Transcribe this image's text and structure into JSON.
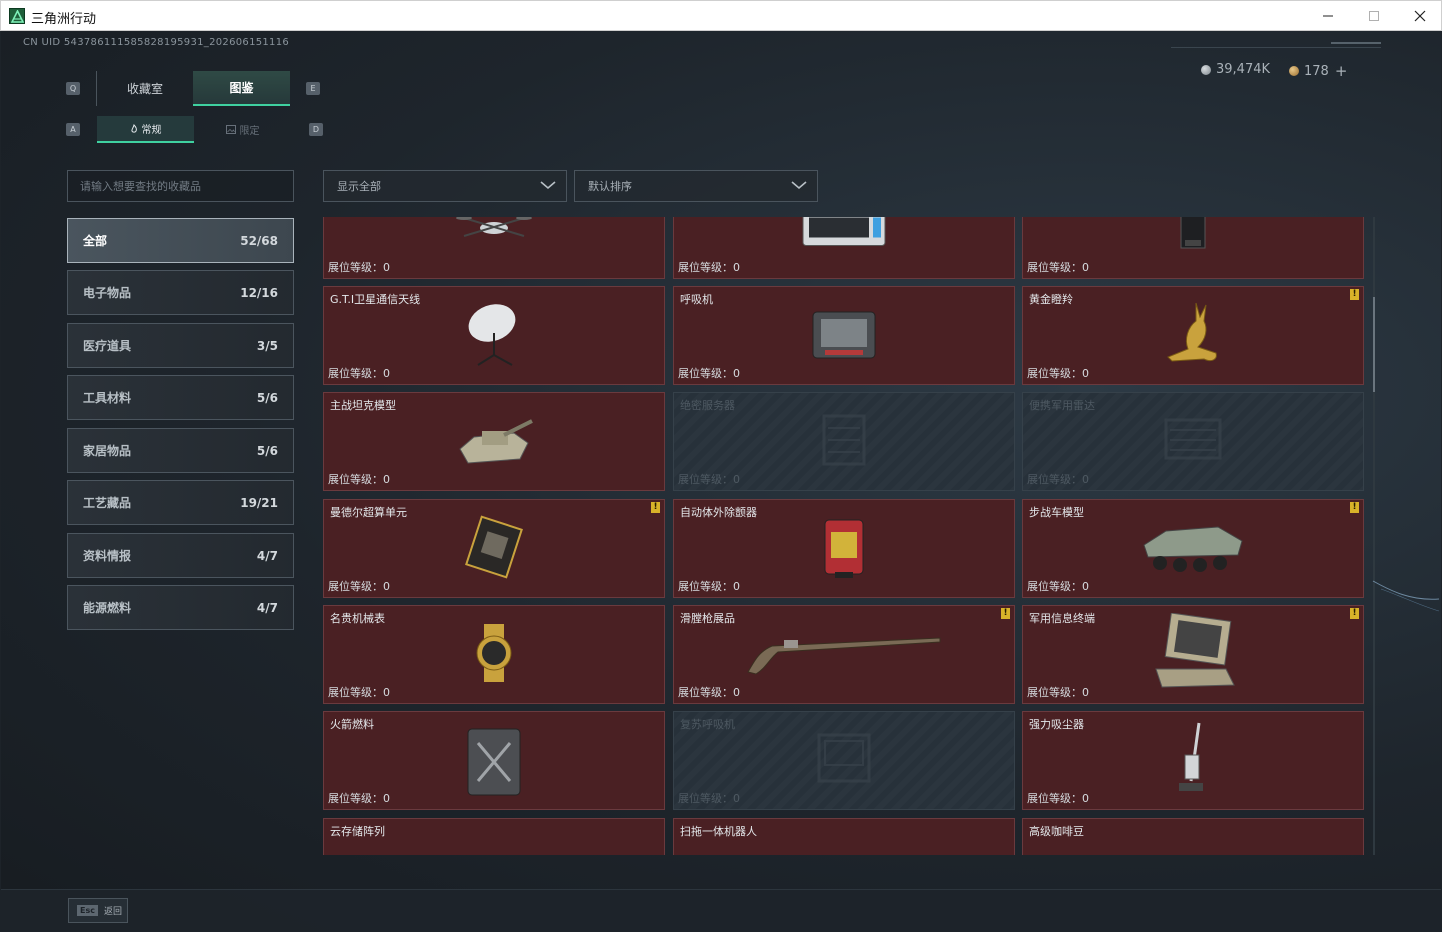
{
  "window": {
    "title": "三角洲行动"
  },
  "header": {
    "uid": "CN UID 5437861115858281959​31_202606151116",
    "currency1": "39,474K",
    "currency2": "178",
    "plus": "+"
  },
  "keys": {
    "q": "Q",
    "e": "E",
    "a": "A",
    "d": "D"
  },
  "tabs": {
    "collection": "收藏室",
    "codex": "图鉴"
  },
  "subtabs": {
    "normal": "常规",
    "limited": "限定"
  },
  "search": {
    "placeholder": "请输入想要查找的收藏品"
  },
  "filters": {
    "display": "显示全部",
    "sort": "默认排序"
  },
  "categories": [
    {
      "label": "全部",
      "count": "52/68"
    },
    {
      "label": "电子物品",
      "count": "12/16"
    },
    {
      "label": "医疗道具",
      "count": "3/5"
    },
    {
      "label": "工具材料",
      "count": "5/6"
    },
    {
      "label": "家居物品",
      "count": "5/6"
    },
    {
      "label": "工艺藏品",
      "count": "19/21"
    },
    {
      "label": "资料情报",
      "count": "4/7"
    },
    {
      "label": "能源燃料",
      "count": "4/7"
    }
  ],
  "level_label": "展位等级：",
  "level_value": "0",
  "badge": "!",
  "items": [
    {
      "name": "",
      "icon": "drone-icon",
      "locked": false,
      "alert": false
    },
    {
      "name": "",
      "icon": "server-icon",
      "locked": false,
      "alert": false
    },
    {
      "name": "",
      "icon": "tower-icon",
      "locked": false,
      "alert": false
    },
    {
      "name": "G.T.I卫星通信天线",
      "icon": "satellite-dish-icon",
      "locked": false,
      "alert": false
    },
    {
      "name": "呼吸机",
      "icon": "ventilator-icon",
      "locked": false,
      "alert": false
    },
    {
      "name": "黄金瞪羚",
      "icon": "gold-gazelle-icon",
      "locked": false,
      "alert": true
    },
    {
      "name": "主战坦克模型",
      "icon": "tank-icon",
      "locked": false,
      "alert": false
    },
    {
      "name": "绝密服务器",
      "icon": "server-rack-icon",
      "locked": true,
      "alert": false
    },
    {
      "name": "便携军用雷达",
      "icon": "radar-icon",
      "locked": true,
      "alert": false
    },
    {
      "name": "曼德尔超算单元",
      "icon": "processor-icon",
      "locked": false,
      "alert": true
    },
    {
      "name": "自动体外除颤器",
      "icon": "defibrillator-icon",
      "locked": false,
      "alert": false
    },
    {
      "name": "步战车模型",
      "icon": "ifv-icon",
      "locked": false,
      "alert": true
    },
    {
      "name": "名贵机械表",
      "icon": "watch-icon",
      "locked": false,
      "alert": false
    },
    {
      "name": "滑膛枪展品",
      "icon": "musket-icon",
      "locked": false,
      "alert": true
    },
    {
      "name": "军用信息终端",
      "icon": "terminal-icon",
      "locked": false,
      "alert": true
    },
    {
      "name": "火箭燃料",
      "icon": "fuel-can-icon",
      "locked": false,
      "alert": false
    },
    {
      "name": "复苏呼吸机",
      "icon": "resuscitator-icon",
      "locked": true,
      "alert": false
    },
    {
      "name": "强力吸尘器",
      "icon": "vacuum-icon",
      "locked": false,
      "alert": false
    },
    {
      "name": "云存储阵列",
      "icon": "storage-array-icon",
      "locked": false,
      "alert": false
    },
    {
      "name": "扫拖一体机器人",
      "icon": "robot-icon",
      "locked": false,
      "alert": false
    },
    {
      "name": "高级咖啡豆",
      "icon": "coffee-icon",
      "locked": false,
      "alert": false
    }
  ],
  "footer": {
    "esc_key": "Esc",
    "back": "返回"
  },
  "colors": {
    "accent": "#3fd1a0",
    "card": "#4a2023",
    "alert": "#d8b229"
  }
}
